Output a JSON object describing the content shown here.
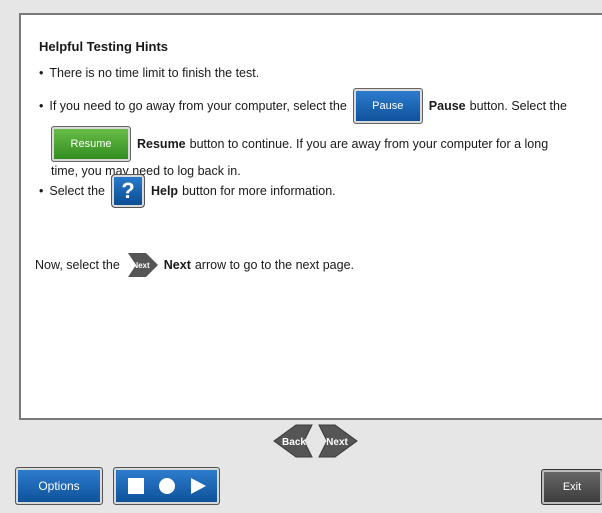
{
  "hints": {
    "title": "Helpful Testing Hints",
    "bullet": "•",
    "line1": "There is no time limit to finish the test.",
    "line2_pre": "If you need to go away from your computer, select the",
    "pause_btn_label": "Pause",
    "pause_word": "Pause",
    "line2_post": "button. Select the",
    "resume_btn_label": "Resume",
    "resume_word": "Resume",
    "line3_post": "button to continue. If you are away from your computer for a long",
    "line4": "time, you may need to log back in.",
    "line5_pre": "Select the",
    "help_glyph": "?",
    "help_word": "Help",
    "line5_post": "button for more information.",
    "now_pre": "Now, select the",
    "next_icon_label": "Next",
    "next_word": "Next",
    "now_post": "arrow to go to the next page."
  },
  "nav": {
    "back_label": "Back",
    "next_label": "Next"
  },
  "toolbar": {
    "options_label": "Options",
    "exit_label": "Exit",
    "media_icons": [
      "stop-icon",
      "record-icon",
      "play-icon"
    ]
  },
  "colors": {
    "button_blue": "#0d4f98",
    "button_green": "#2f8a1e",
    "exit_gray": "#3a3a3a",
    "arrow_gray": "#555555"
  }
}
